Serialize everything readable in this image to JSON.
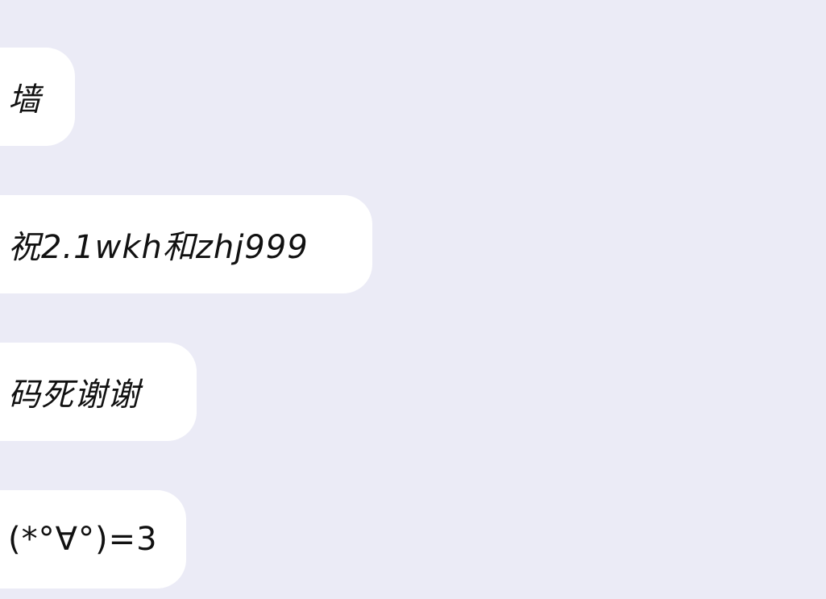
{
  "chat": {
    "messages": [
      {
        "text": "墙"
      },
      {
        "text": "祝2.1wkh和zhj999"
      },
      {
        "text": "码死谢谢"
      },
      {
        "text": "(*°∀°)=3"
      }
    ]
  },
  "colors": {
    "background": "#ebebf6",
    "bubble": "#ffffff",
    "text": "#111111"
  }
}
